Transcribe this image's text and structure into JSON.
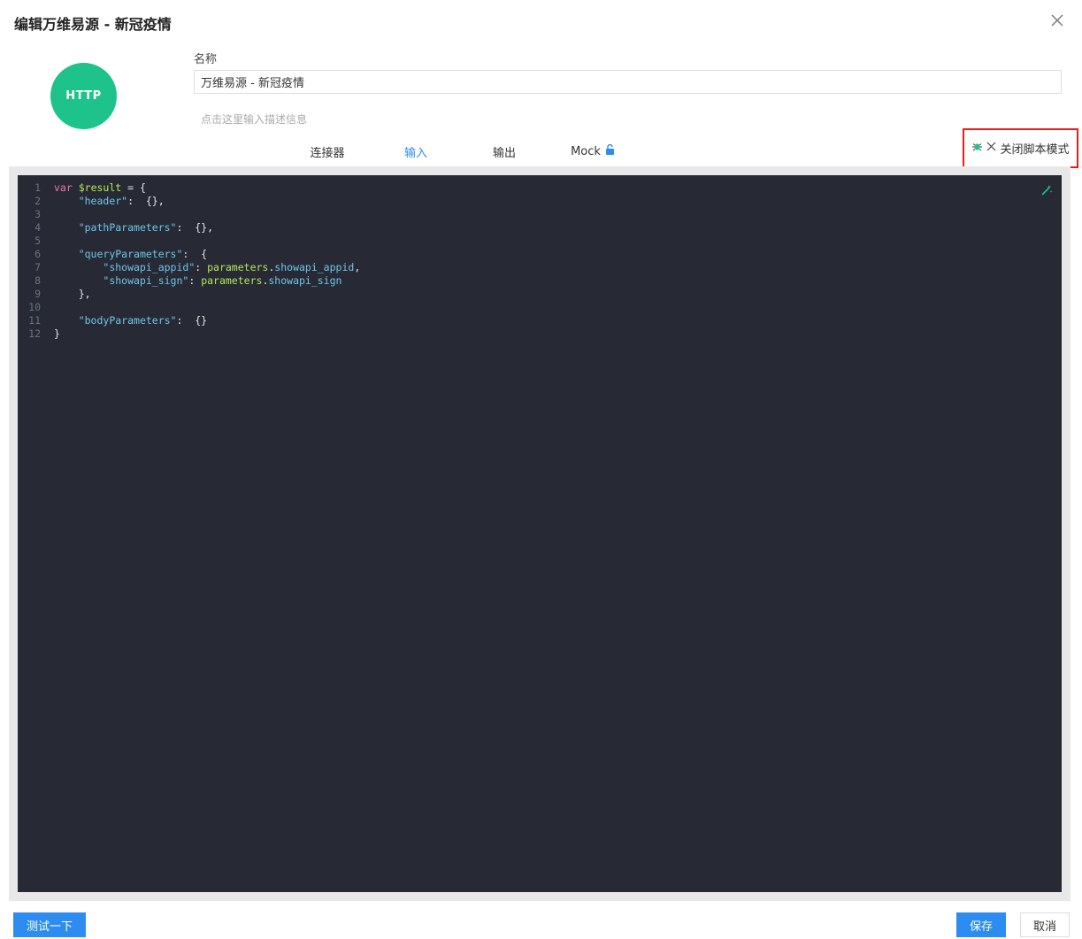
{
  "dialog": {
    "title": "编辑万维易源 - 新冠疫情",
    "close_icon": "close-icon"
  },
  "logo": {
    "text": "HTTP",
    "color": "#1ec28b"
  },
  "form": {
    "name_label": "名称",
    "name_value": "万维易源 - 新冠疫情",
    "description_placeholder": "点击这里输入描述信息"
  },
  "tabs": [
    {
      "label": "连接器",
      "active": false
    },
    {
      "label": "输入",
      "active": true
    },
    {
      "label": "输出",
      "active": false
    },
    {
      "label": "Mock",
      "active": false,
      "icon": "lock-open-icon"
    }
  ],
  "script_toggle": {
    "label": "关闭脚本模式",
    "icons": [
      "bug-icon",
      "close-icon"
    ]
  },
  "editor": {
    "lines": [
      {
        "n": "1",
        "tokens": [
          [
            "kw",
            "var"
          ],
          [
            "punc",
            " "
          ],
          [
            "var",
            "$result"
          ],
          [
            "punc",
            " = {"
          ]
        ]
      },
      {
        "n": "2",
        "tokens": [
          [
            "punc",
            "    "
          ],
          [
            "str",
            "\"header\""
          ],
          [
            "punc",
            ":  {},"
          ]
        ]
      },
      {
        "n": "3",
        "tokens": []
      },
      {
        "n": "4",
        "tokens": [
          [
            "punc",
            "    "
          ],
          [
            "str",
            "\"pathParameters\""
          ],
          [
            "punc",
            ":  {},"
          ]
        ]
      },
      {
        "n": "5",
        "tokens": []
      },
      {
        "n": "6",
        "tokens": [
          [
            "punc",
            "    "
          ],
          [
            "str",
            "\"queryParameters\""
          ],
          [
            "punc",
            ":  {"
          ]
        ]
      },
      {
        "n": "7",
        "tokens": [
          [
            "punc",
            "        "
          ],
          [
            "str",
            "\"showapi_appid\""
          ],
          [
            "punc",
            ": "
          ],
          [
            "ref",
            "parameters"
          ],
          [
            "punc",
            "."
          ],
          [
            "str",
            "showapi_appid"
          ],
          [
            "punc",
            ","
          ]
        ]
      },
      {
        "n": "8",
        "tokens": [
          [
            "punc",
            "        "
          ],
          [
            "str",
            "\"showapi_sign\""
          ],
          [
            "punc",
            ": "
          ],
          [
            "ref",
            "parameters"
          ],
          [
            "punc",
            "."
          ],
          [
            "str",
            "showapi_sign"
          ]
        ]
      },
      {
        "n": "9",
        "tokens": [
          [
            "punc",
            "    },"
          ]
        ]
      },
      {
        "n": "10",
        "tokens": []
      },
      {
        "n": "11",
        "tokens": [
          [
            "punc",
            "    "
          ],
          [
            "str",
            "\"bodyParameters\""
          ],
          [
            "punc",
            ":  {}"
          ]
        ]
      },
      {
        "n": "12",
        "tokens": [
          [
            "punc",
            "}"
          ]
        ]
      }
    ],
    "tool_icon": "magic-wand-icon"
  },
  "footer": {
    "test_label": "测试一下",
    "save_label": "保存",
    "cancel_label": "取消"
  }
}
